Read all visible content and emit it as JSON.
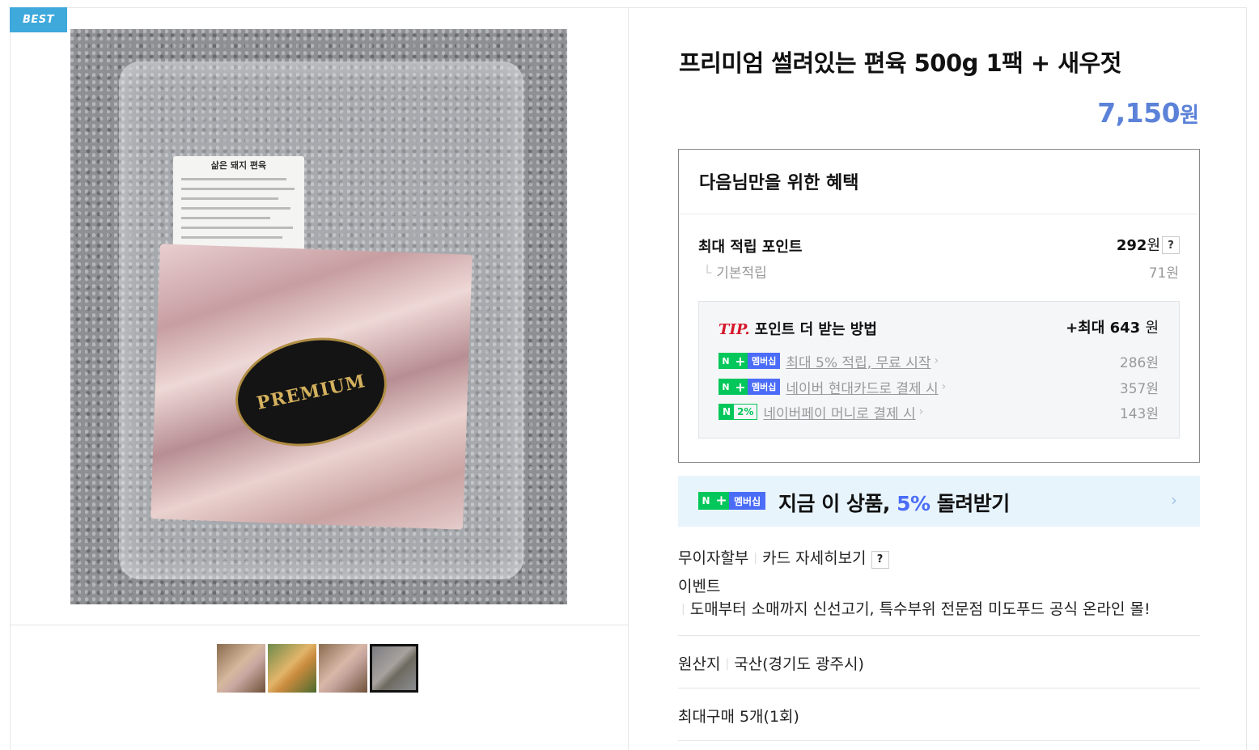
{
  "badge": {
    "best": "BEST"
  },
  "image": {
    "label_title": "삶은 돼지 편육",
    "seal_text": "PREMIUM"
  },
  "product": {
    "title": "프리미엄 썰려있는 편육 500g 1팩 + 새우젓",
    "price": "7,150",
    "price_unit": "원"
  },
  "benefit": {
    "title": "다음님만을 위한 혜택",
    "max_point_label": "최대 적립 포인트",
    "max_point_value": "292",
    "unit": "원",
    "help": "?",
    "basic_label": "기본적립",
    "basic_value": "71원",
    "tip": {
      "mark": "TIP.",
      "title": "포인트 더 받는 방법",
      "max_prefix": "+최대",
      "max_value": "643",
      "max_unit": "원",
      "badge_n": "N",
      "badge_plus": "+",
      "badge_member": "멤버십",
      "badge_pay_pct": "2%",
      "rows": [
        {
          "text": "최대 5% 적립, 무료 시작",
          "amount": "286원"
        },
        {
          "text": "네이버 현대카드로 결제 시",
          "amount": "357원"
        },
        {
          "text": "네이버페이 머니로 결제 시",
          "amount": "143원"
        }
      ]
    }
  },
  "promo": {
    "n": "N",
    "plus": "+",
    "member": "멤버십",
    "text_before": "지금 이 상품, ",
    "highlight": "5%",
    "text_after": " 돌려받기",
    "chevron": "›"
  },
  "info": {
    "installment": "무이자할부",
    "card_detail": "카드 자세히보기",
    "help": "?",
    "event_label": "이벤트",
    "event_text": "도매부터 소매까지 신선고기, 특수부위 전문점 미도푸드 공식 온라인 몰!",
    "origin_label": "원산지",
    "origin_value": "국산(경기도 광주시)",
    "max_purchase": "최대구매 5개(1회)"
  },
  "colors": {
    "price": "#5b82d8",
    "naver_green": "#03c75a",
    "membership_blue": "#4a6cf7",
    "tip_red": "#d6172a",
    "best_badge": "#3fa9dc"
  }
}
